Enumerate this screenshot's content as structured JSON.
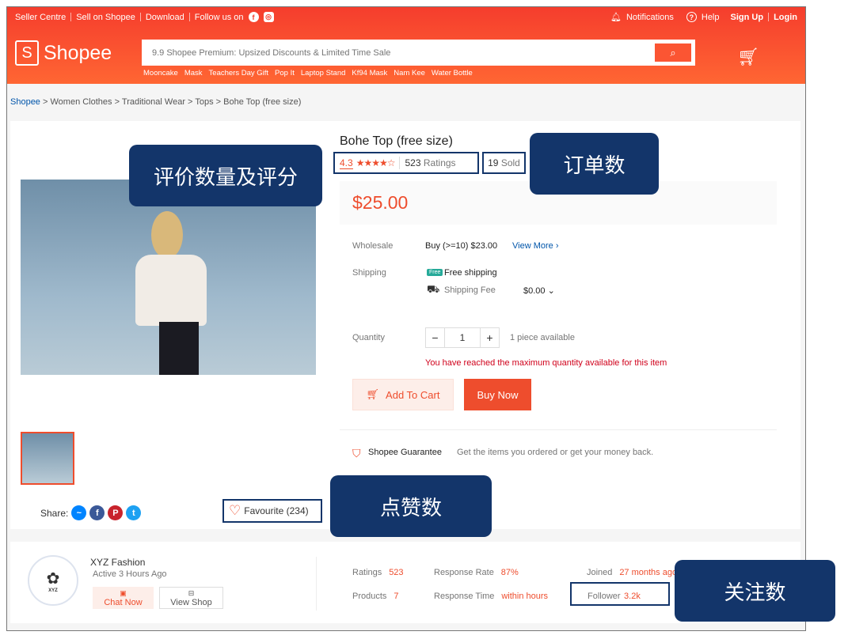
{
  "header": {
    "top_links": [
      "Seller Centre",
      "Sell on Shopee",
      "Download",
      "Follow us on"
    ],
    "notifications": "Notifications",
    "help": "Help",
    "sign_up": "Sign Up",
    "login": "Login",
    "logo": "Shopee",
    "search_placeholder": "9.9 Shopee Premium: Upsized Discounts & Limited Time Sale",
    "hints": [
      "Mooncake",
      "Mask",
      "Teachers Day Gift",
      "Pop It",
      "Laptop Stand",
      "Kf94 Mask",
      "Nam Kee",
      "Water Bottle"
    ],
    "brand_color": "#ee4d2d"
  },
  "breadcrumb": [
    "Shopee",
    "Women Clothes",
    "Traditional Wear",
    "Tops",
    "Bohe Top (free size)"
  ],
  "product": {
    "title": "Bohe Top (free size)",
    "rating": "4.3",
    "rating_stars": 4.3,
    "ratings_count": "523",
    "ratings_label": "Ratings",
    "sold_count": "19",
    "sold_label": "Sold",
    "price": "$25.00",
    "wholesale_label": "Wholesale",
    "wholesale_value": "Buy (>=10) $23.00",
    "view_more": "View More",
    "shipping_label": "Shipping",
    "free_shipping": "Free shipping",
    "free_badge": "Free",
    "shipping_fee_label": "Shipping Fee",
    "shipping_fee": "$0.00",
    "quantity_label": "Quantity",
    "quantity": "1",
    "available": "1 piece available",
    "max_warning": "You have reached the maximum quantity available for this item",
    "add_to_cart": "Add To Cart",
    "buy_now": "Buy Now",
    "guarantee": "Shopee Guarantee",
    "guarantee_text": "Get the items you ordered or get your money back.",
    "share_label": "Share:",
    "favourite": "Favourite (234)"
  },
  "shop": {
    "name": "XYZ Fashion",
    "logo_text": "XYZ",
    "active": "Active 3 Hours Ago",
    "chat": "Chat Now",
    "view_shop": "View Shop",
    "stats": [
      {
        "label": "Ratings",
        "value": "523"
      },
      {
        "label": "Response Rate",
        "value": "87%"
      },
      {
        "label": "Joined",
        "value": "27 months ago"
      },
      {
        "label": "Products",
        "value": "7"
      },
      {
        "label": "Response Time",
        "value": "within hours"
      },
      {
        "label": "Follower",
        "value": "3.2k"
      }
    ]
  },
  "callouts": {
    "ratings": "评价数量及评分",
    "orders": "订单数",
    "likes": "点赞数",
    "followers": "关注数"
  }
}
